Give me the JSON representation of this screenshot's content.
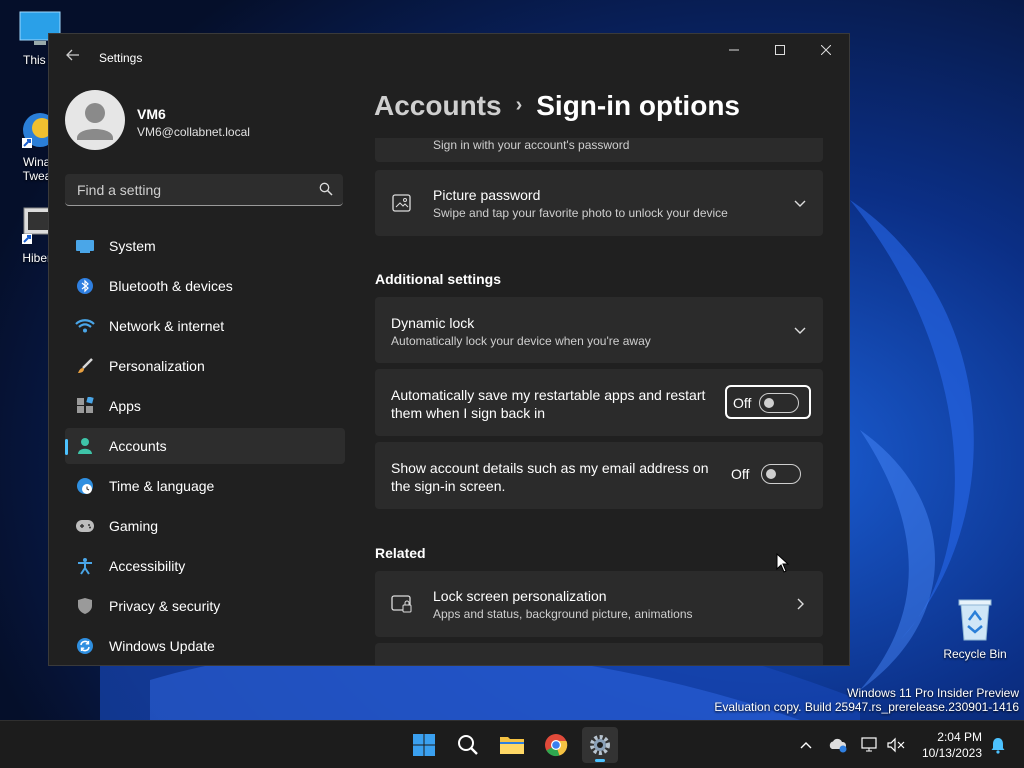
{
  "desktop": {
    "icons": [
      {
        "label": "This P"
      },
      {
        "label": "Winae\nTweak"
      },
      {
        "label": "Hibern"
      }
    ],
    "recycle_bin": "Recycle Bin",
    "watermark_line1": "Windows 11 Pro Insider Preview",
    "watermark_line2": "Evaluation copy. Build 25947.rs_prerelease.230901-1416"
  },
  "window": {
    "title": "Settings",
    "controls": {
      "minimize": "minimize-icon",
      "maximize": "maximize-icon",
      "close": "close-icon"
    }
  },
  "user": {
    "name": "VM6",
    "email": "VM6@collabnet.local"
  },
  "search": {
    "placeholder": "Find a setting"
  },
  "nav": {
    "items": [
      {
        "label": "System",
        "icon": "system-icon"
      },
      {
        "label": "Bluetooth & devices",
        "icon": "bluetooth-icon"
      },
      {
        "label": "Network & internet",
        "icon": "wifi-icon"
      },
      {
        "label": "Personalization",
        "icon": "brush-icon"
      },
      {
        "label": "Apps",
        "icon": "apps-icon"
      },
      {
        "label": "Accounts",
        "icon": "accounts-icon",
        "active": true
      },
      {
        "label": "Time & language",
        "icon": "globe-clock-icon"
      },
      {
        "label": "Gaming",
        "icon": "gamepad-icon"
      },
      {
        "label": "Accessibility",
        "icon": "accessibility-icon"
      },
      {
        "label": "Privacy & security",
        "icon": "shield-icon"
      },
      {
        "label": "Windows Update",
        "icon": "update-icon"
      }
    ]
  },
  "breadcrumb": {
    "parent": "Accounts",
    "current": "Sign-in options"
  },
  "main": {
    "password_card": {
      "subtitle": "Sign in with your account's password"
    },
    "picture_password": {
      "title": "Picture password",
      "subtitle": "Swipe and tap your favorite photo to unlock your device"
    },
    "additional_settings_header": "Additional settings",
    "dynamic_lock": {
      "title": "Dynamic lock",
      "subtitle": "Automatically lock your device when you're away"
    },
    "restart_apps": {
      "title_line1": "Automatically save my restartable apps and restart",
      "title_line2": "them when I sign back in",
      "state": "Off"
    },
    "account_details": {
      "title_line1": "Show account details such as my email address on",
      "title_line2": "the sign-in screen.",
      "state": "Off"
    },
    "related_header": "Related",
    "lock_screen": {
      "title": "Lock screen personalization",
      "subtitle": "Apps and status, background picture, animations"
    }
  },
  "taskbar": {
    "clock_time": "2:04 PM",
    "clock_date": "10/13/2023"
  },
  "colors": {
    "accent": "#4cc2ff",
    "window_bg": "#202020",
    "card_bg": "#2b2b2b"
  }
}
